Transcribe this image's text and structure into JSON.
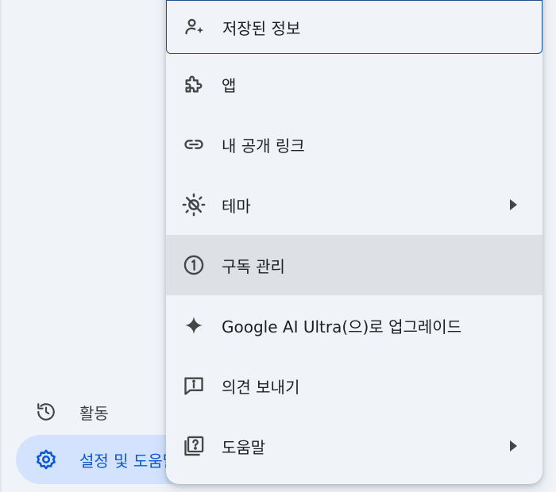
{
  "sidebar": {
    "activity_label": "활동",
    "settings_label": "설정 및 도움말"
  },
  "menu": {
    "items": [
      {
        "label": "저장된 정보",
        "icon": "person-sparkle-icon"
      },
      {
        "label": "앱",
        "icon": "puzzle-icon"
      },
      {
        "label": "내 공개 링크",
        "icon": "link-icon"
      },
      {
        "label": "테마",
        "icon": "theme-icon",
        "submenu": true
      },
      {
        "label": "구독 관리",
        "icon": "subscription-icon"
      },
      {
        "label": "Google AI Ultra(으)로 업그레이드",
        "icon": "sparkle-icon"
      },
      {
        "label": "의견 보내기",
        "icon": "feedback-icon"
      },
      {
        "label": "도움말",
        "icon": "help-icon",
        "submenu": true
      }
    ]
  },
  "colors": {
    "background": "#f0f4f9",
    "settings_active_bg": "#d3e3fd",
    "settings_active_text": "#0b57d0",
    "hover_bg": "#dde1e6",
    "focus_border": "#1f4e8c"
  }
}
